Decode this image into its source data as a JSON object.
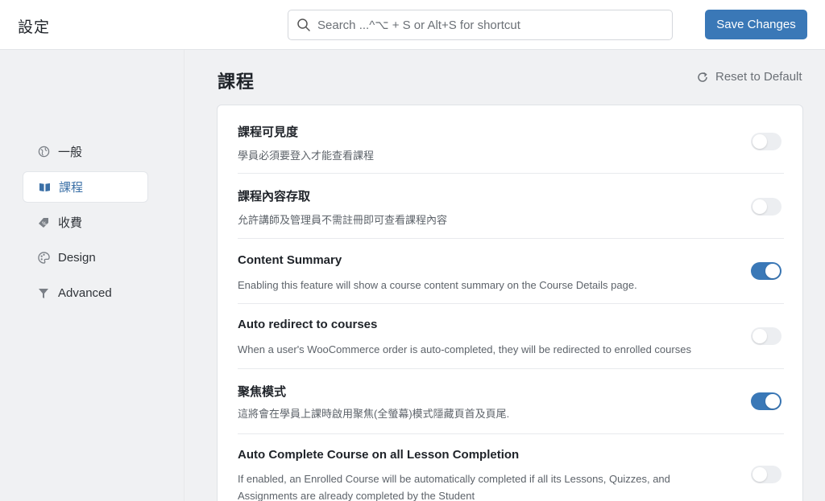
{
  "header": {
    "title": "設定",
    "search_placeholder": "Search ...^⌥ + S or Alt+S for shortcut",
    "save_label": "Save Changes"
  },
  "sidebar": {
    "items": [
      {
        "label": "一般",
        "icon": "globe-icon",
        "active": false
      },
      {
        "label": "課程",
        "icon": "book-icon",
        "active": true
      },
      {
        "label": "收費",
        "icon": "price-tag-icon",
        "active": false
      },
      {
        "label": "Design",
        "icon": "palette-icon",
        "active": false
      },
      {
        "label": "Advanced",
        "icon": "filter-icon",
        "active": false
      }
    ]
  },
  "main": {
    "title": "課程",
    "reset_label": "Reset to Default",
    "settings": [
      {
        "label": "課程可見度",
        "description": "學員必須要登入才能查看課程",
        "enabled": false
      },
      {
        "label": "課程內容存取",
        "description": "允許講師及管理員不需註冊即可查看課程內容",
        "enabled": false
      },
      {
        "label": "Content Summary",
        "description": "Enabling this feature will show a course content summary on the Course Details page.",
        "enabled": true
      },
      {
        "label": "Auto redirect to courses",
        "description": "When a user's WooCommerce order is auto-completed, they will be redirected to enrolled courses",
        "enabled": false
      },
      {
        "label": "聚焦模式",
        "description": "這將會在學員上課時啟用聚焦(全螢幕)模式隱藏頁首及頁尾.",
        "enabled": true
      },
      {
        "label": "Auto Complete Course on all Lesson Completion",
        "description": "If enabled, an Enrolled Course will be automatically completed if all its Lessons, Quizzes, and Assignments are already completed by the Student",
        "enabled": false
      }
    ]
  },
  "colors": {
    "accent": "#3a78b7",
    "active_nav_text": "#3a6fa6",
    "background": "#f0f1f3"
  }
}
